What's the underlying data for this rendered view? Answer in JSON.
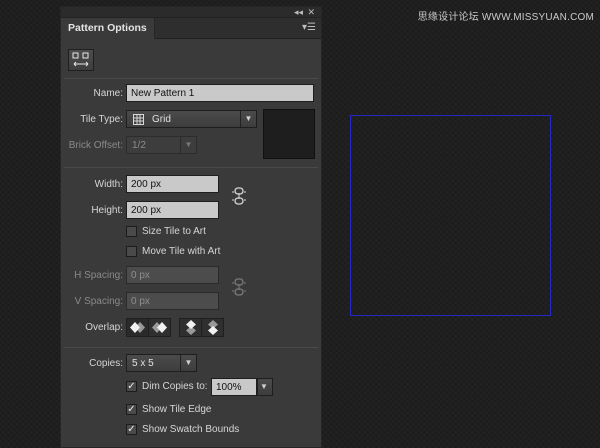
{
  "watermark": "思缘设计论坛 WWW.MISSYUAN.COM",
  "panel": {
    "collapse_icon": "◂◂",
    "close_icon": "✕",
    "tab_title": "Pattern Options",
    "menu_icon": "▾☰"
  },
  "fields": {
    "name_label": "Name:",
    "name_value": "New Pattern 1",
    "tile_type_label": "Tile Type:",
    "tile_type_value": "Grid",
    "brick_offset_label": "Brick Offset:",
    "brick_offset_value": "1/2",
    "width_label": "Width:",
    "width_value": "200 px",
    "height_label": "Height:",
    "height_value": "200 px",
    "size_tile_label": "Size Tile to Art",
    "move_tile_label": "Move Tile with Art",
    "h_spacing_label": "H Spacing:",
    "h_spacing_value": "0 px",
    "v_spacing_label": "V Spacing:",
    "v_spacing_value": "0 px",
    "overlap_label": "Overlap:",
    "copies_label": "Copies:",
    "copies_value": "5 x 5",
    "dim_copies_label": "Dim Copies to:",
    "dim_copies_value": "100%",
    "show_tile_edge_label": "Show Tile Edge",
    "show_swatch_bounds_label": "Show Swatch Bounds"
  },
  "state": {
    "size_tile_to_art": false,
    "move_tile_with_art": false,
    "dim_copies": true,
    "show_tile_edge": true,
    "show_swatch_bounds": true
  },
  "colors": {
    "tile_boundary": "#2727c8",
    "panel_bg": "#3a3a3a",
    "canvas_bg": "#1d1d1d"
  }
}
